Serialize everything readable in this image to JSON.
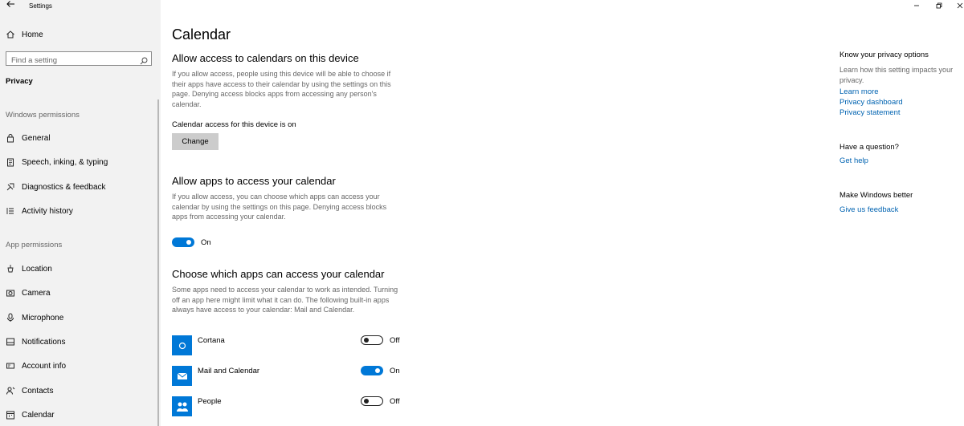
{
  "window": {
    "title": "Settings"
  },
  "sidebar": {
    "home_label": "Home",
    "search_placeholder": "Find a setting",
    "privacy_label": "Privacy",
    "windows_permissions_label": "Windows permissions",
    "windows_items": [
      {
        "label": "General",
        "icon": "lock-icon"
      },
      {
        "label": "Speech, inking, & typing",
        "icon": "clipboard-icon"
      },
      {
        "label": "Diagnostics & feedback",
        "icon": "diagnostics-icon"
      },
      {
        "label": "Activity history",
        "icon": "history-icon"
      }
    ],
    "app_permissions_label": "App permissions",
    "app_items": [
      {
        "label": "Location",
        "icon": "location-icon"
      },
      {
        "label": "Camera",
        "icon": "camera-icon"
      },
      {
        "label": "Microphone",
        "icon": "microphone-icon"
      },
      {
        "label": "Notifications",
        "icon": "notifications-icon"
      },
      {
        "label": "Account info",
        "icon": "account-icon"
      },
      {
        "label": "Contacts",
        "icon": "contacts-icon"
      },
      {
        "label": "Calendar",
        "icon": "calendar-icon"
      }
    ]
  },
  "main": {
    "title": "Calendar",
    "device_section": {
      "heading": "Allow access to calendars on this device",
      "description": "If you allow access, people using this device will be able to choose if their apps have access to their calendar by using the settings on this page. Denying access blocks apps from accessing any person's calendar.",
      "status": "Calendar access for this device is on",
      "button_label": "Change"
    },
    "apps_section": {
      "heading": "Allow apps to access your calendar",
      "description": "If you allow access, you can choose which apps can access your calendar by using the settings on this page. Denying access blocks apps from accessing your calendar.",
      "toggle_state": "On"
    },
    "choose_section": {
      "heading": "Choose which apps can access your calendar",
      "description": "Some apps need to access your calendar to work as intended. Turning off an app here might limit what it can do. The following built-in apps always have access to your calendar: Mail and Calendar.",
      "apps": [
        {
          "name": "Cortana",
          "state": "Off",
          "icon": "cortana-icon"
        },
        {
          "name": "Mail and Calendar",
          "state": "On",
          "icon": "mail-icon"
        },
        {
          "name": "People",
          "state": "Off",
          "icon": "people-icon"
        }
      ]
    }
  },
  "right_panel": {
    "privacy_heading": "Know your privacy options",
    "privacy_desc": "Learn how this setting impacts your privacy.",
    "links": [
      "Learn more",
      "Privacy dashboard",
      "Privacy statement"
    ],
    "question_heading": "Have a question?",
    "help_link": "Get help",
    "better_heading": "Make Windows better",
    "feedback_link": "Give us feedback"
  },
  "colors": {
    "accent": "#0078d7",
    "link": "#0063b1",
    "sidebar_bg": "#f2f2f2"
  }
}
